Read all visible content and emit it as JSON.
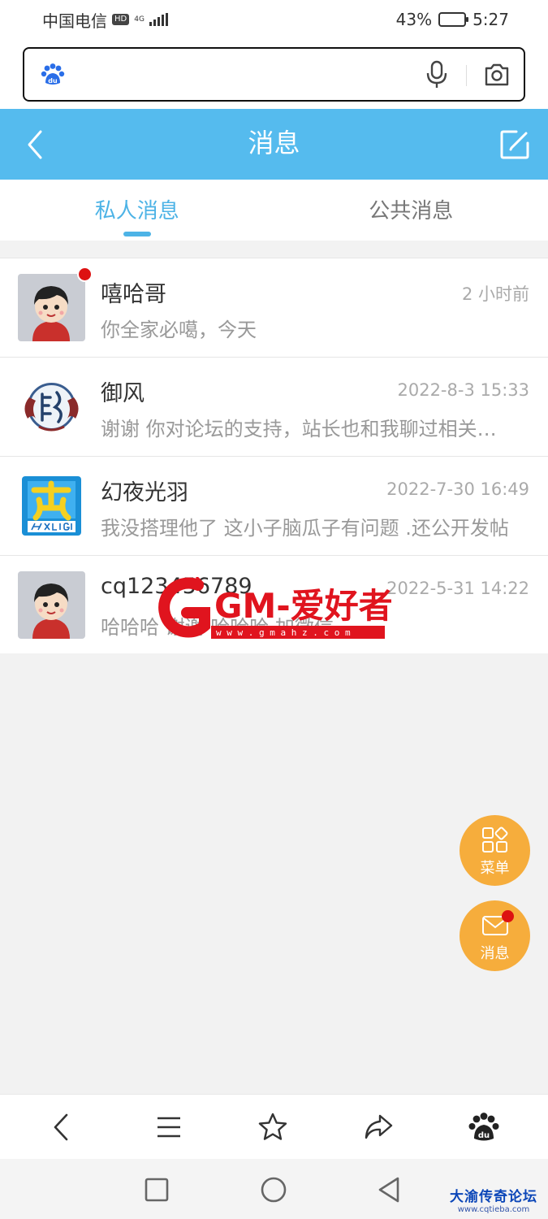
{
  "status_bar": {
    "carrier": "中国电信",
    "hd_badge": "HD",
    "network_type": "4G",
    "battery_percent": "43%",
    "battery_level": 0.43,
    "time": "5:27"
  },
  "browser": {
    "search_value": "",
    "search_placeholder": "",
    "logo_text": "du"
  },
  "header": {
    "title": "消息"
  },
  "tabs": [
    {
      "label": "私人消息",
      "active": true
    },
    {
      "label": "公共消息",
      "active": false
    }
  ],
  "messages": [
    {
      "name": "嘻哈哥",
      "time": "2 小时前",
      "preview": "你全家必噶，今天",
      "unread": true,
      "avatar": "cartoon-boy"
    },
    {
      "name": "御风",
      "time": "2022-8-3 15:33",
      "preview": "谢谢 你对论坛的支持，站长也和我聊过相关情况",
      "unread": false,
      "avatar": "seal-emblem"
    },
    {
      "name": "幻夜光羽",
      "time": "2022-7-30 16:49",
      "preview": "我没搭理他了 这小子脑瓜子有问题 .还公开发帖",
      "unread": false,
      "avatar": "hxlight-logo"
    },
    {
      "name": "cq123456789",
      "time": "2022-5-31 14:22",
      "preview": "哈哈哈 谢谢 哈哈哈 加微信",
      "unread": false,
      "avatar": "cartoon-boy"
    }
  ],
  "watermark": {
    "brand": "GM-爱好者",
    "url": "w w w . g m a h z . c o m"
  },
  "fab": {
    "menu_label": "菜单",
    "message_label": "消息",
    "message_unread": true
  },
  "forum_mark": {
    "title": "大渝传奇论坛",
    "url": "www.cqtieba.com"
  },
  "colors": {
    "header_bg": "#55bbee",
    "accent": "#4db3e6",
    "fab_bg": "#f6ad3c",
    "unread": "#dd1111",
    "page_bg": "#f2f2f2"
  }
}
